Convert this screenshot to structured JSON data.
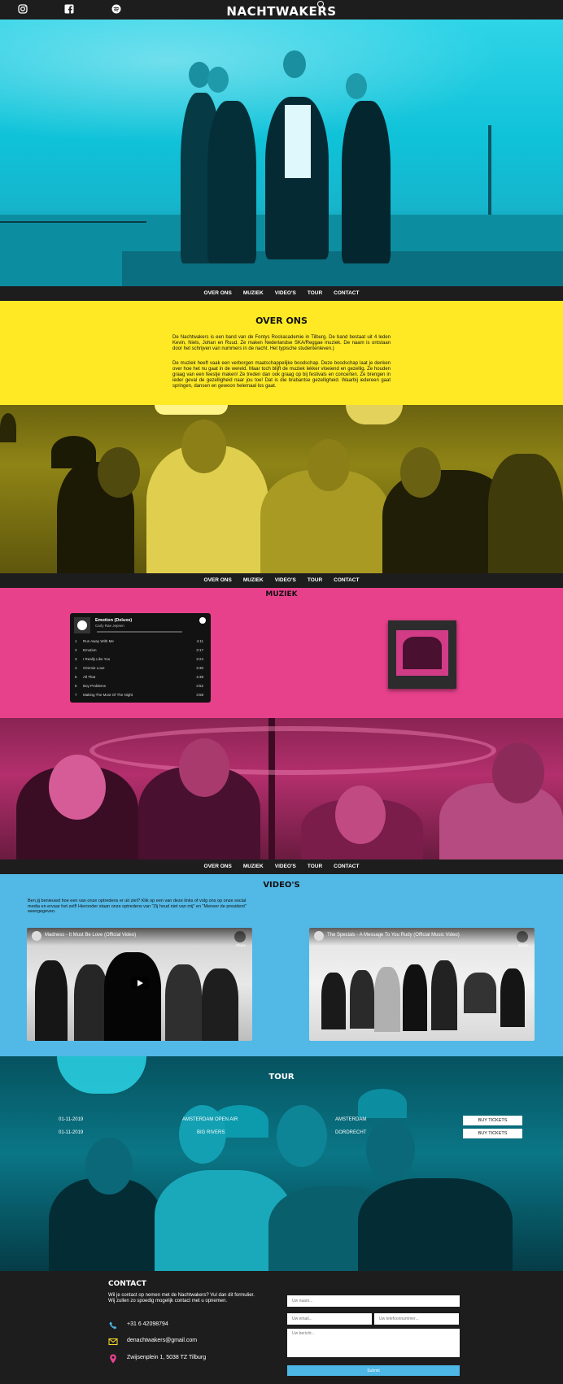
{
  "header": {
    "brand": "NACHTWAKERS",
    "social": [
      "instagram-icon",
      "facebook-icon",
      "spotify-icon"
    ]
  },
  "nav": {
    "items": [
      "OVER ONS",
      "MUZIEK",
      "VIDEO'S",
      "TOUR",
      "CONTACT"
    ]
  },
  "about": {
    "title": "OVER ONS",
    "p1": "De Nachtwakers is een band van de Fontys Rockacademie in Tilburg. De band bestaat uit 4 leden Kevin, Niels, Johan en Ruud. Ze maken Nederlandse SKA/Reggae muziek. De naam is ontstaan door het schrijven van nummers in de nacht. Het typische studentenleven.)",
    "p2": "De muziek heeft vaak een verborgen maatschappelijke boodschap. Deze boodschap laat je denken over hoe het nu gaat in de wereld. Maar toch blijft de muziek lekker vloeiend en gezellig. Ze houden graag van een feestje maken! Ze treden dan ook graag op bij festivals en concerten. Ze brengen in ieder geval de gezelligheid naar jou toe! Dat is die brabantse gezelligheid. Waarbij iedereen gaat springen, dansen en gewoon helemaal los gaat."
  },
  "music": {
    "title": "MUZIEK",
    "player": {
      "album": "Emotion (Deluxe)",
      "artist": "Carly Rae Jepsen",
      "tracks": [
        {
          "n": "1",
          "name": "Run Away With Me",
          "dur": "4:11"
        },
        {
          "n": "2",
          "name": "Emotion",
          "dur": "3:17"
        },
        {
          "n": "3",
          "name": "I Really Like You",
          "dur": "3:24"
        },
        {
          "n": "4",
          "name": "Gimmie Love",
          "dur": "3:30"
        },
        {
          "n": "5",
          "name": "All That",
          "dur": "4:38"
        },
        {
          "n": "6",
          "name": "Boy Problems",
          "dur": "3:52"
        },
        {
          "n": "7",
          "name": "Making The Most Of The Night",
          "dur": "3:58"
        }
      ]
    }
  },
  "videos": {
    "title": "VIDEO'S",
    "intro": "Ben jij benieuwd hoe een van onze optredens er uit ziet? Klik op een van deze links of volg ons op onze social media en ervaar het zelf! Hieronder staan onze optredens van \"Zij houd niet van mij\" en \"Meneer de president\" weergegeven.",
    "items": [
      {
        "title": "Madness - It Must Be Love (Official Video)"
      },
      {
        "title": "The Specials - A Message To You Rudy (Official Music Video)"
      }
    ],
    "share": "Share"
  },
  "tour": {
    "title": "TOUR",
    "rows": [
      {
        "date": "01-11-2019",
        "event": "AMSTERDAM OPEN AIR",
        "city": "AMSTERDAM",
        "button": "BUY TICKETS"
      },
      {
        "date": "01-11-2019",
        "event": "BIG RIVERS",
        "city": "DORDRECHT",
        "button": "BUY TICKETS"
      }
    ]
  },
  "contact": {
    "title": "CONTACT",
    "intro": "Wil je contact op nemen met de Nachtwakers? Vul dan dit formulier. Wij zullen zo spoedig mogelijk contact met u opnemen.",
    "phone": "+31 6 42098794",
    "email": "denachtwakers@gmail.com",
    "address": "Zwijsenplein 1, 5038 TZ Tilburg",
    "form": {
      "name_placeholder": "Uw naam...",
      "email_placeholder": "Uw email...",
      "tel_placeholder": "Uw telefoonnummer...",
      "message_placeholder": "Uw bericht...",
      "submit": "Submit"
    }
  },
  "colors": {
    "cyan": "#1cc9dd",
    "yellow": "#fee924",
    "pink": "#e8418c",
    "blue": "#52b8e6",
    "dark": "#1d1d1d"
  }
}
